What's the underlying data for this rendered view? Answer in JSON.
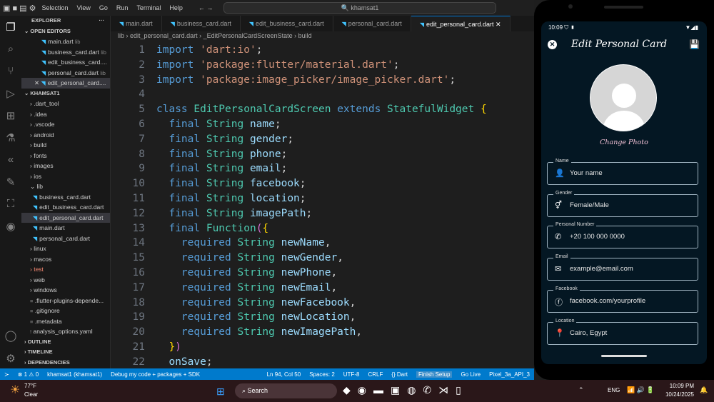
{
  "menu": [
    "Selection",
    "View",
    "Go",
    "Run",
    "Terminal",
    "Help"
  ],
  "search": "khamsat1",
  "explorer": {
    "title": "EXPLORER",
    "open_editors": "OPEN EDITORS",
    "open": [
      {
        "name": "main.dart",
        "hint": "lib"
      },
      {
        "name": "business_card.dart",
        "hint": "lib"
      },
      {
        "name": "edit_business_card....",
        "hint": ""
      },
      {
        "name": "personal_card.dart",
        "hint": "lib"
      },
      {
        "name": "edit_personal_card....",
        "hint": ""
      }
    ],
    "project": "KHAMSAT1",
    "tree": [
      ".dart_tool",
      ".idea",
      ".vscode",
      "android",
      "build",
      "fonts",
      "images",
      "ios",
      "lib"
    ],
    "lib_files": [
      "business_card.dart",
      "edit_business_card.dart",
      "edit_personal_card.dart",
      "main.dart",
      "personal_card.dart"
    ],
    "tree2": [
      "linux",
      "macos",
      "test",
      "web",
      "windows"
    ],
    "files": [
      ".flutter-plugins-depende...",
      ".gitignore",
      ".metadata",
      "analysis_options.yaml"
    ],
    "sections": [
      "OUTLINE",
      "TIMELINE",
      "DEPENDENCIES"
    ]
  },
  "tabs": [
    "main.dart",
    "business_card.dart",
    "edit_business_card.dart",
    "personal_card.dart",
    "edit_personal_card.dart"
  ],
  "breadcrumb": [
    "lib",
    "edit_personal_card.dart",
    "_EditPersonalCardScreenState",
    "build"
  ],
  "code": [
    [
      [
        "import ",
        "k"
      ],
      [
        "'dart:io'",
        "s"
      ],
      [
        ";",
        "p"
      ]
    ],
    [
      [
        "import ",
        "k"
      ],
      [
        "'package:flutter/material.dart'",
        "s"
      ],
      [
        ";",
        "p"
      ]
    ],
    [
      [
        "import ",
        "k"
      ],
      [
        "'package:image_picker/image_picker.dart'",
        "s"
      ],
      [
        ";",
        "p"
      ]
    ],
    [],
    [
      [
        "class ",
        "k"
      ],
      [
        "EditPersonalCardScreen ",
        "t"
      ],
      [
        "extends ",
        "k"
      ],
      [
        "StatefulWidget ",
        "t"
      ],
      [
        "{",
        "y"
      ]
    ],
    [
      [
        "  final ",
        "k"
      ],
      [
        "String ",
        "t"
      ],
      [
        "name",
        "v"
      ],
      [
        ";",
        "p"
      ]
    ],
    [
      [
        "  final ",
        "k"
      ],
      [
        "String ",
        "t"
      ],
      [
        "gender",
        "v"
      ],
      [
        ";",
        "p"
      ]
    ],
    [
      [
        "  final ",
        "k"
      ],
      [
        "String ",
        "t"
      ],
      [
        "phone",
        "v"
      ],
      [
        ";",
        "p"
      ]
    ],
    [
      [
        "  final ",
        "k"
      ],
      [
        "String ",
        "t"
      ],
      [
        "email",
        "v"
      ],
      [
        ";",
        "p"
      ]
    ],
    [
      [
        "  final ",
        "k"
      ],
      [
        "String ",
        "t"
      ],
      [
        "facebook",
        "v"
      ],
      [
        ";",
        "p"
      ]
    ],
    [
      [
        "  final ",
        "k"
      ],
      [
        "String ",
        "t"
      ],
      [
        "location",
        "v"
      ],
      [
        ";",
        "p"
      ]
    ],
    [
      [
        "  final ",
        "k"
      ],
      [
        "String ",
        "t"
      ],
      [
        "imagePath",
        "v"
      ],
      [
        ";",
        "p"
      ]
    ],
    [
      [
        "  final ",
        "k"
      ],
      [
        "Function",
        "t"
      ],
      [
        "(",
        "m"
      ],
      [
        "{",
        "y"
      ]
    ],
    [
      [
        "    required ",
        "k"
      ],
      [
        "String ",
        "t"
      ],
      [
        "newName",
        "v"
      ],
      [
        ",",
        "p"
      ]
    ],
    [
      [
        "    required ",
        "k"
      ],
      [
        "String ",
        "t"
      ],
      [
        "newGender",
        "v"
      ],
      [
        ",",
        "p"
      ]
    ],
    [
      [
        "    required ",
        "k"
      ],
      [
        "String ",
        "t"
      ],
      [
        "newPhone",
        "v"
      ],
      [
        ",",
        "p"
      ]
    ],
    [
      [
        "    required ",
        "k"
      ],
      [
        "String ",
        "t"
      ],
      [
        "newEmail",
        "v"
      ],
      [
        ",",
        "p"
      ]
    ],
    [
      [
        "    required ",
        "k"
      ],
      [
        "String ",
        "t"
      ],
      [
        "newFacebook",
        "v"
      ],
      [
        ",",
        "p"
      ]
    ],
    [
      [
        "    required ",
        "k"
      ],
      [
        "String ",
        "t"
      ],
      [
        "newLocation",
        "v"
      ],
      [
        ",",
        "p"
      ]
    ],
    [
      [
        "    required ",
        "k"
      ],
      [
        "String ",
        "t"
      ],
      [
        "newImagePath",
        "v"
      ],
      [
        ",",
        "p"
      ]
    ],
    [
      [
        "  ",
        "p"
      ],
      [
        "}",
        "y"
      ],
      [
        ")",
        "m"
      ]
    ],
    [
      [
        "  onSave",
        "v"
      ],
      [
        ";",
        "p"
      ]
    ]
  ],
  "status": {
    "left": [
      "⊗ 1 ⚠ 0",
      "khamsat1 (khamsat1)",
      "Debug my code + packages + SDK"
    ],
    "right": [
      "Ln 94, Col 50",
      "Spaces: 2",
      "UTF-8",
      "CRLF",
      "{} Dart",
      "Finish Setup",
      "Go Live",
      "Pixel_3a_API_3"
    ]
  },
  "taskbar": {
    "temp": "77°F",
    "weather": "Clear",
    "search": "Search",
    "lang": "ENG",
    "time": "10:09 PM",
    "date": "10/24/2025"
  },
  "phone": {
    "clock": "10:09",
    "title": "Edit Personal Card",
    "change_photo": "Change Photo",
    "fields": [
      {
        "label": "Name",
        "value": "Your name",
        "icon": "person-icon"
      },
      {
        "label": "Gender",
        "value": "Female/Male",
        "icon": "wc-icon"
      },
      {
        "label": "Personal Number",
        "value": "+20 100 000 0000",
        "icon": "phone-icon"
      },
      {
        "label": "Email",
        "value": "example@email.com",
        "icon": "email-icon"
      },
      {
        "label": "Facebook",
        "value": "facebook.com/yourprofile",
        "icon": "facebook-icon"
      },
      {
        "label": "Location",
        "value": "Cairo, Egypt",
        "icon": "location-icon"
      }
    ]
  },
  "colors": {
    "statusbar": "#007acc",
    "phone_bg": "#041723",
    "accent_pink": "#f4c2d7"
  }
}
